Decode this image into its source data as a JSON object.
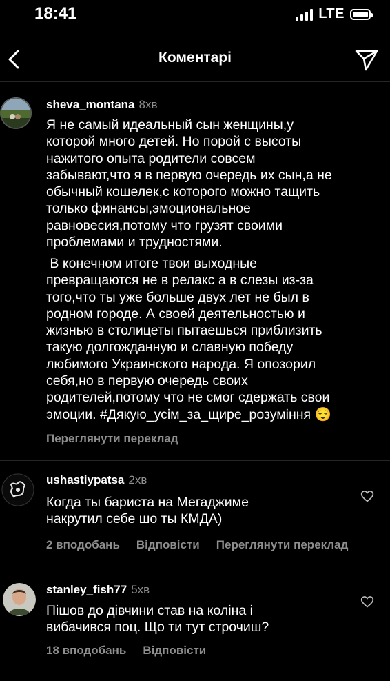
{
  "status_bar": {
    "time": "18:41",
    "network": "LTE"
  },
  "header": {
    "title": "Коментарі"
  },
  "comments": [
    {
      "username": "sheva_montana",
      "age": "8хв",
      "paragraph1": "Я не самый идеальный сын женщины,у\nкоторой много детей. Но порой с высоты\nнажитого опыта родители совсем\nзабывают,что я в первую очередь их сын,а не\nобычный кошелек,с которого можно тащить\nтолько финансы,эмоциональное\nравновесия,потому что грузят своими\nпроблемами и трудностями.",
      "paragraph2": " В конечном итоге твои выходные\nпревращаются не в релакс а в слезы из-за\nтого,что ты уже больше двух лет не был в\nродном городе. А своей деятельностью и\nжизнью в столицеты пытаешься приблизить\nтакую долгожданную и славную победу\nлюбимого Украинского народа. Я опозорил\nсебя,но в первую очередь своих\nродителей,потому что не смог сдержать свои\nэмоции. #Дякую_усім_за_щире_розуміння ",
      "emoji": "😌",
      "translate": "Переглянути переклад"
    },
    {
      "username": "ushastiypatsa",
      "age": "2хв",
      "text": "Когда ты бариста на Мегаджиме\nнакрутил себе шо ты КМДА)",
      "likes": "2 вподобань",
      "reply": "Відповісти",
      "translate": "Переглянути переклад"
    },
    {
      "username": "stanley_fish77",
      "age": "5хв",
      "text": "Пішов до дівчини став на коліна і\nвибачився поц. Що ти тут строчиш?",
      "likes": "18 вподобань",
      "reply": "Відповісти"
    }
  ],
  "icons": {
    "back": "chevron-left-icon",
    "send": "paper-plane-icon",
    "like": "heart-outline-icon"
  },
  "colors": {
    "background": "#000000",
    "text": "#ffffff",
    "secondary": "#8e8e8e"
  }
}
